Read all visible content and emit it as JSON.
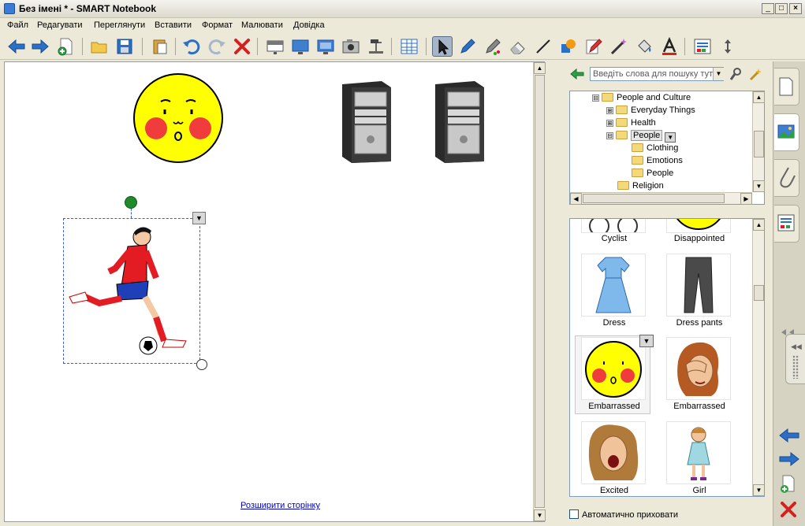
{
  "window": {
    "title": "Без імені * - SMART Notebook",
    "min": "_",
    "max": "□",
    "close": "×"
  },
  "menu": [
    "Файл",
    "Редагувати",
    "Переглянути",
    "Вставити",
    "Формат",
    "Малювати",
    "Довідка"
  ],
  "canvas": {
    "extend_link": "Розширити сторінку"
  },
  "gallery": {
    "search_placeholder": "Введіть слова для пошуку тут",
    "tree": [
      {
        "label": "People and Culture",
        "expander": "⊟"
      },
      {
        "label": "Everyday Things",
        "expander": "⊞"
      },
      {
        "label": "Health",
        "expander": "⊞"
      },
      {
        "label": "People",
        "expander": "⊟"
      },
      {
        "label": "Clothing"
      },
      {
        "label": "Emotions"
      },
      {
        "label": "People"
      },
      {
        "label": "Religion"
      }
    ],
    "items": [
      {
        "label": "Cyclist"
      },
      {
        "label": "Disappointed"
      },
      {
        "label": "Dress"
      },
      {
        "label": "Dress pants"
      },
      {
        "label": "Embarrassed"
      },
      {
        "label": "Embarrassed"
      },
      {
        "label": "Excited"
      },
      {
        "label": "Girl"
      }
    ],
    "autohide_label": "Автоматично приховати"
  },
  "colors": {
    "accent": "#2b6fc7",
    "select_border": "#3b5bd6",
    "delete": "#d42020"
  }
}
